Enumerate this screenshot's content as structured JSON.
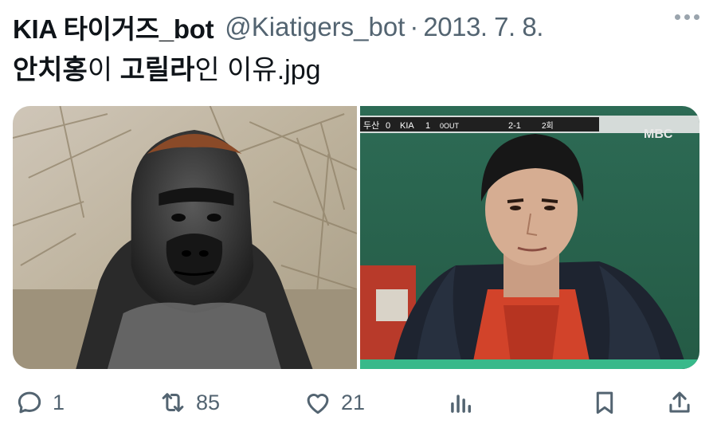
{
  "tweet": {
    "author_name": "KIA 타이거즈_bot",
    "handle": "@Kiatigers_bot",
    "separator": "·",
    "date": "2013. 7. 8.",
    "text_bold_1": "안치홍",
    "text_1": "이 ",
    "text_bold_2": "고릴라",
    "text_2": "인 이유.jpg"
  },
  "media": {
    "left_image": "gorilla-photo",
    "right_image": "baseball-player-broadcast-photo",
    "scoreboard": {
      "team_1": "두산",
      "team_1_score": "0",
      "team_2": "KIA",
      "team_2_score": "1",
      "outs": "0OUT",
      "count": "2-1",
      "inning": "2회"
    },
    "broadcaster_logo": "MBC"
  },
  "actions": {
    "reply_count": "1",
    "retweet_count": "85",
    "like_count": "21"
  },
  "icons": {
    "reply": "reply-icon",
    "retweet": "retweet-icon",
    "like": "heart-icon",
    "views": "views-chart-icon",
    "bookmark": "bookmark-icon",
    "share": "share-icon",
    "more": "more-icon"
  },
  "colors": {
    "text": "#0f1419",
    "secondary": "#536471"
  }
}
